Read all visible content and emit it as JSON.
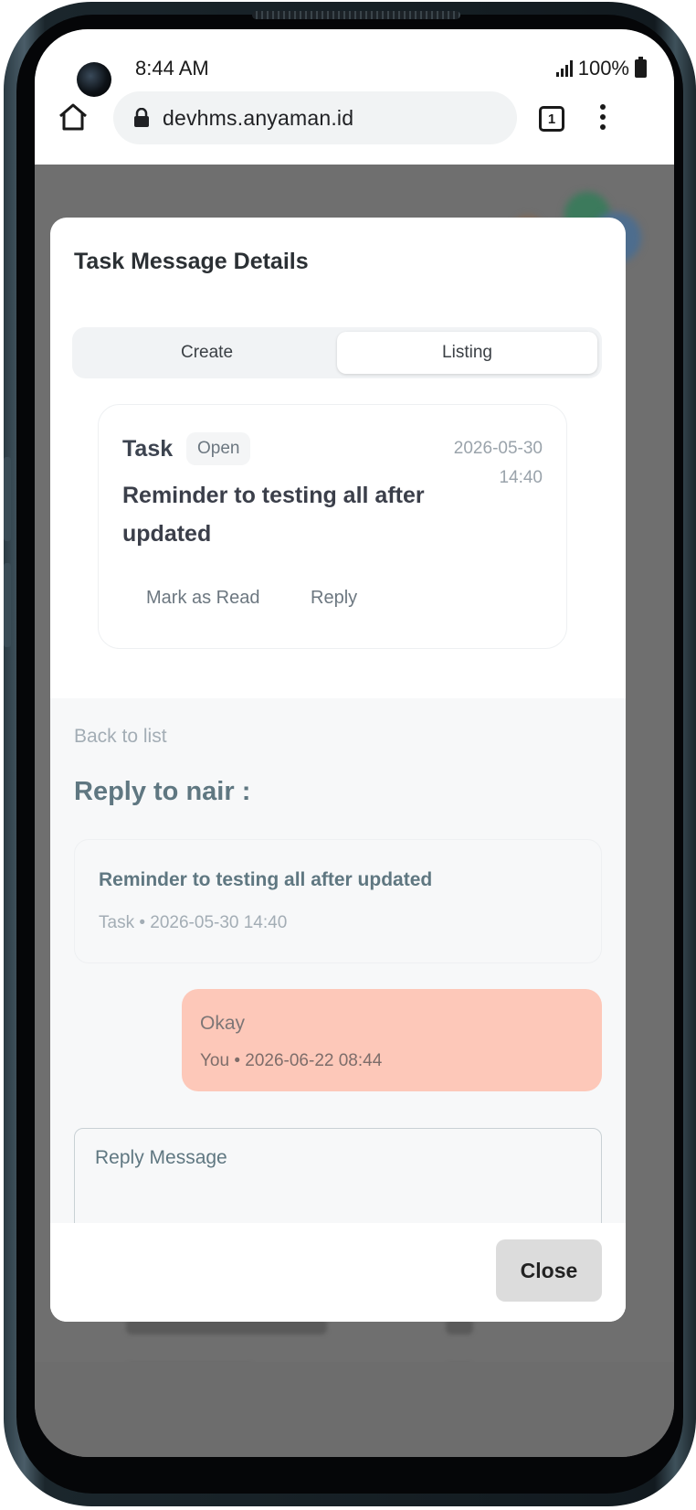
{
  "status_bar": {
    "time": "8:44 AM",
    "battery": "100%"
  },
  "browser": {
    "url": "devhms.anyaman.id",
    "tab_count": "1"
  },
  "modal": {
    "title": "Task Message Details",
    "tabs": [
      {
        "label": "Create",
        "active": false
      },
      {
        "label": "Listing",
        "active": true
      }
    ],
    "task": {
      "type": "Task",
      "status": "Open",
      "date": "2026-05-30",
      "time": "14:40",
      "body": "Reminder to testing all after updated",
      "actions": {
        "mark_read": "Mark as Read",
        "reply": "Reply"
      }
    },
    "reply": {
      "back_label": "Back to list",
      "heading": "Reply to nair :",
      "original": {
        "text": "Reminder to testing all after updated",
        "meta": "Task • 2026-05-30 14:40"
      },
      "messages": [
        {
          "text": "Okay",
          "meta": "You • 2026-06-22 08:44"
        }
      ],
      "input_placeholder": "Reply Message"
    },
    "close_label": "Close"
  },
  "colors": {
    "overlay": "#6f6f6f",
    "bubble": "#fdc8b9",
    "heading_teal": "#5f7781",
    "close_button": "#dcdcdc"
  }
}
